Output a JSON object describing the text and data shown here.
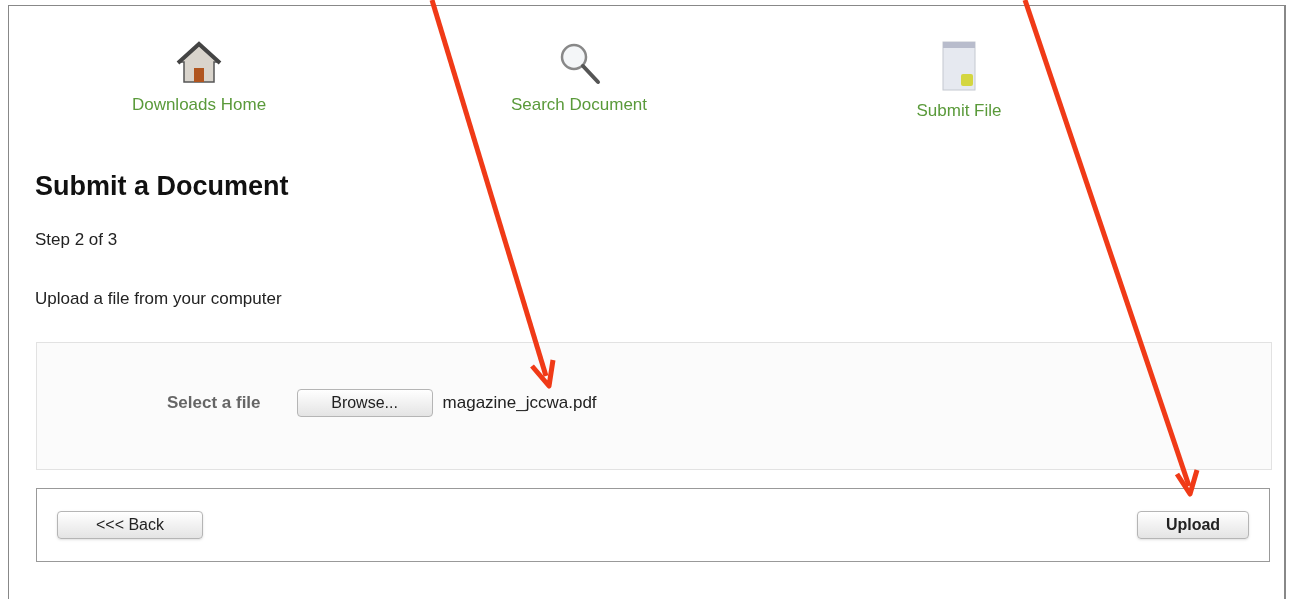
{
  "nav": [
    {
      "label": "Downloads Home",
      "kind": "home"
    },
    {
      "label": "Search Document",
      "kind": "search"
    },
    {
      "label": "Submit File",
      "kind": "file"
    }
  ],
  "title": "Submit a Document",
  "step": "Step 2 of 3",
  "instruction": "Upload a file from your computer",
  "file_field": {
    "label": "Select a file",
    "button": "Browse...",
    "value": "magazine_jccwa.pdf"
  },
  "buttons": [
    {
      "label": "<<< Back",
      "kind": "back"
    },
    {
      "label": "Upload",
      "kind": "upload"
    }
  ]
}
